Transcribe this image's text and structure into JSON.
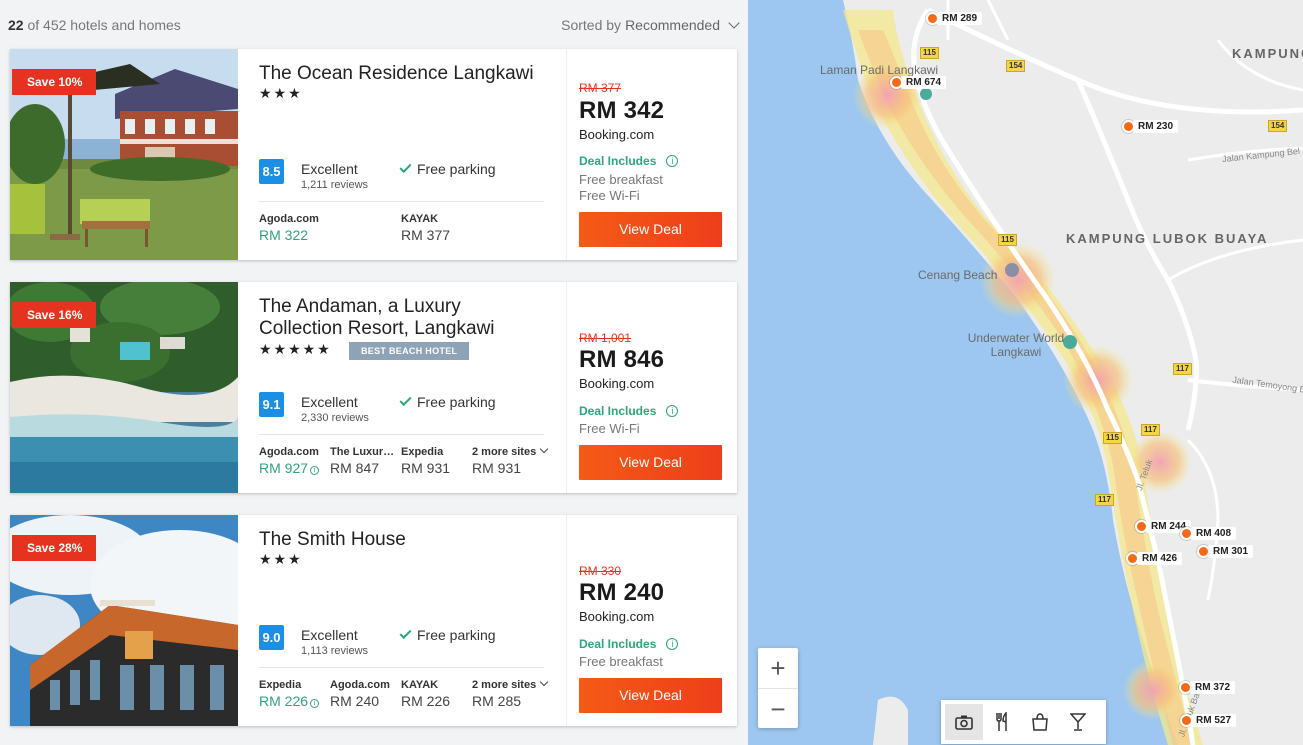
{
  "header": {
    "count_bold": "22",
    "count_rest": "of 452 hotels and homes",
    "sort_label": "Sorted by",
    "sort_value": "Recommended"
  },
  "hotels": [
    {
      "save": "Save 10%",
      "name": "The Ocean Residence Langkawi",
      "stars": "★★★",
      "tag": "",
      "score": "8.5",
      "rating": "Excellent",
      "reviews": "1,211 reviews",
      "amenity": "Free parking",
      "sites": [
        {
          "name": "Agoda.com",
          "price": "RM 322"
        },
        {
          "name": "KAYAK",
          "price": "RM 377"
        }
      ],
      "old_price": "RM 377",
      "price": "RM 342",
      "provider": "Booking.com",
      "deal_includes": "Deal Includes",
      "perks": [
        "Free breakfast",
        "Free Wi-Fi"
      ],
      "button": "View Deal"
    },
    {
      "save": "Save 16%",
      "name": "The Andaman, a Luxury Collection Resort, Langkawi",
      "stars": "★★★★★",
      "tag": "BEST BEACH HOTEL",
      "score": "9.1",
      "rating": "Excellent",
      "reviews": "2,330 reviews",
      "amenity": "Free parking",
      "sites": [
        {
          "name": "Agoda.com",
          "price": "RM 927"
        },
        {
          "name": "The Luxury Collection",
          "price": "RM 847"
        },
        {
          "name": "Expedia",
          "price": "RM 931"
        },
        {
          "name": "2 more sites",
          "price": "RM 931"
        }
      ],
      "old_price": "RM 1,001",
      "price": "RM 846",
      "provider": "Booking.com",
      "deal_includes": "Deal Includes",
      "perks": [
        "Free Wi-Fi"
      ],
      "button": "View Deal"
    },
    {
      "save": "Save 28%",
      "name": "The Smith House",
      "stars": "★★★",
      "tag": "",
      "score": "9.0",
      "rating": "Excellent",
      "reviews": "1,113 reviews",
      "amenity": "Free parking",
      "sites": [
        {
          "name": "Expedia",
          "price": "RM 226"
        },
        {
          "name": "Agoda.com",
          "price": "RM 240"
        },
        {
          "name": "KAYAK",
          "price": "RM 226"
        },
        {
          "name": "2 more sites",
          "price": "RM 285"
        }
      ],
      "old_price": "RM 330",
      "price": "RM 240",
      "provider": "Booking.com",
      "deal_includes": "Deal Includes",
      "perks": [
        "Free breakfast"
      ],
      "button": "View Deal"
    }
  ],
  "map": {
    "places": {
      "laman_padi": "Laman Padi Langkawi",
      "kampung_bubor": "KAMPUNG BUBOR",
      "kampung_lubok": "KAMPUNG LUBOK BUAYA",
      "cenang": "Cenang Beach",
      "underwater": "Underwater World Langkawi",
      "jalan_kampung": "Jalan Kampung Bel",
      "jalan_temoyong": "Jalan Temoyong Ba",
      "jl_teluk": "Jl. Teluk",
      "jl_teluk2": "Jl. Teluk Ba"
    },
    "roads": {
      "r115a": "115",
      "r154a": "154",
      "r154b": "154",
      "r115b": "115",
      "r117a": "117",
      "r115c": "115",
      "r117b": "117",
      "r117c": "117"
    },
    "pins": [
      "RM 289",
      "RM 674",
      "RM 230",
      "RM 244",
      "RM 408",
      "RM 426",
      "RM 301",
      "RM 372",
      "RM 527"
    ],
    "zoom_in": "+",
    "zoom_out": "−",
    "poi_icons": [
      "camera-icon",
      "restaurant-icon",
      "shopping-bag-icon",
      "cocktail-icon"
    ]
  }
}
